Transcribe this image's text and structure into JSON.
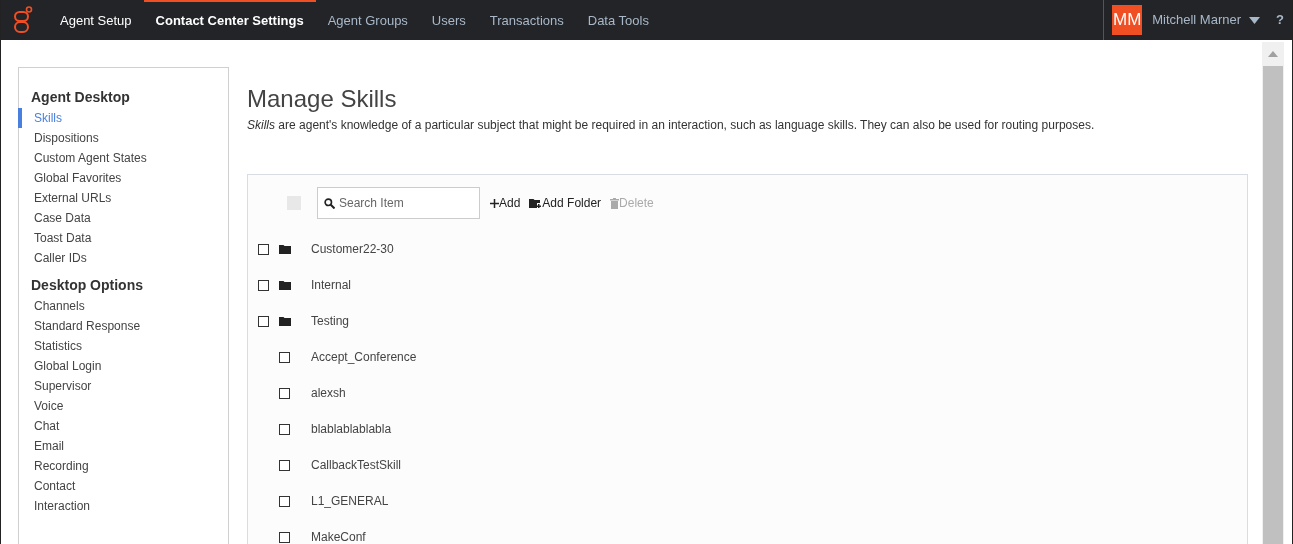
{
  "nav": {
    "tabs": [
      {
        "label": "Agent Setup",
        "selected": false,
        "kind": "app"
      },
      {
        "label": "Contact Center Settings",
        "selected": true,
        "kind": "section"
      },
      {
        "label": "Agent Groups",
        "selected": false,
        "kind": "section"
      },
      {
        "label": "Users",
        "selected": false,
        "kind": "section"
      },
      {
        "label": "Transactions",
        "selected": false,
        "kind": "section"
      },
      {
        "label": "Data Tools",
        "selected": false,
        "kind": "section"
      }
    ],
    "user": {
      "initials": "MM",
      "name": "Mitchell Marner"
    },
    "help": "?"
  },
  "sidebar": {
    "sections": [
      {
        "title": "Agent Desktop",
        "items": [
          {
            "label": "Skills",
            "selected": true
          },
          {
            "label": "Dispositions",
            "selected": false
          },
          {
            "label": "Custom Agent States",
            "selected": false
          },
          {
            "label": "Global Favorites",
            "selected": false
          },
          {
            "label": "External URLs",
            "selected": false
          },
          {
            "label": "Case Data",
            "selected": false
          },
          {
            "label": "Toast Data",
            "selected": false
          },
          {
            "label": "Caller IDs",
            "selected": false
          }
        ]
      },
      {
        "title": "Desktop Options",
        "items": [
          {
            "label": "Channels",
            "selected": false
          },
          {
            "label": "Standard Response",
            "selected": false
          },
          {
            "label": "Statistics",
            "selected": false
          },
          {
            "label": "Global Login",
            "selected": false
          },
          {
            "label": "Supervisor",
            "selected": false
          },
          {
            "label": "Voice",
            "selected": false
          },
          {
            "label": "Chat",
            "selected": false
          },
          {
            "label": "Email",
            "selected": false
          },
          {
            "label": "Recording",
            "selected": false
          },
          {
            "label": "Contact",
            "selected": false
          },
          {
            "label": "Interaction",
            "selected": false
          }
        ]
      }
    ]
  },
  "page": {
    "title": "Manage Skills",
    "description": "*Skills* are agent's knowledge of a particular subject that might be required in an interaction, such as language skills. They can also be used for routing purposes."
  },
  "list": {
    "select_all": {
      "checked": false,
      "disabled": true
    },
    "search": {
      "placeholder": "Search Item"
    },
    "actions": [
      {
        "label": "Add",
        "kind": "add",
        "disabled": false
      },
      {
        "label": "Add Folder",
        "kind": "folder",
        "disabled": false
      },
      {
        "label": "Delete",
        "kind": "delete",
        "disabled": true
      }
    ],
    "items": [
      {
        "label": "Customer22-30",
        "kind": "folder",
        "checked": false
      },
      {
        "label": "Internal",
        "kind": "folder",
        "checked": false
      },
      {
        "label": "Testing",
        "kind": "folder",
        "checked": false
      },
      {
        "label": "Accept_Conference",
        "kind": "skill",
        "checked": false
      },
      {
        "label": "alexsh",
        "kind": "skill",
        "checked": false
      },
      {
        "label": "blablablablabla",
        "kind": "skill",
        "checked": false
      },
      {
        "label": "CallbackTestSkill",
        "kind": "skill",
        "checked": false
      },
      {
        "label": "L1_GENERAL",
        "kind": "skill",
        "checked": false
      },
      {
        "label": "MakeConf",
        "kind": "skill",
        "checked": false
      }
    ]
  }
}
